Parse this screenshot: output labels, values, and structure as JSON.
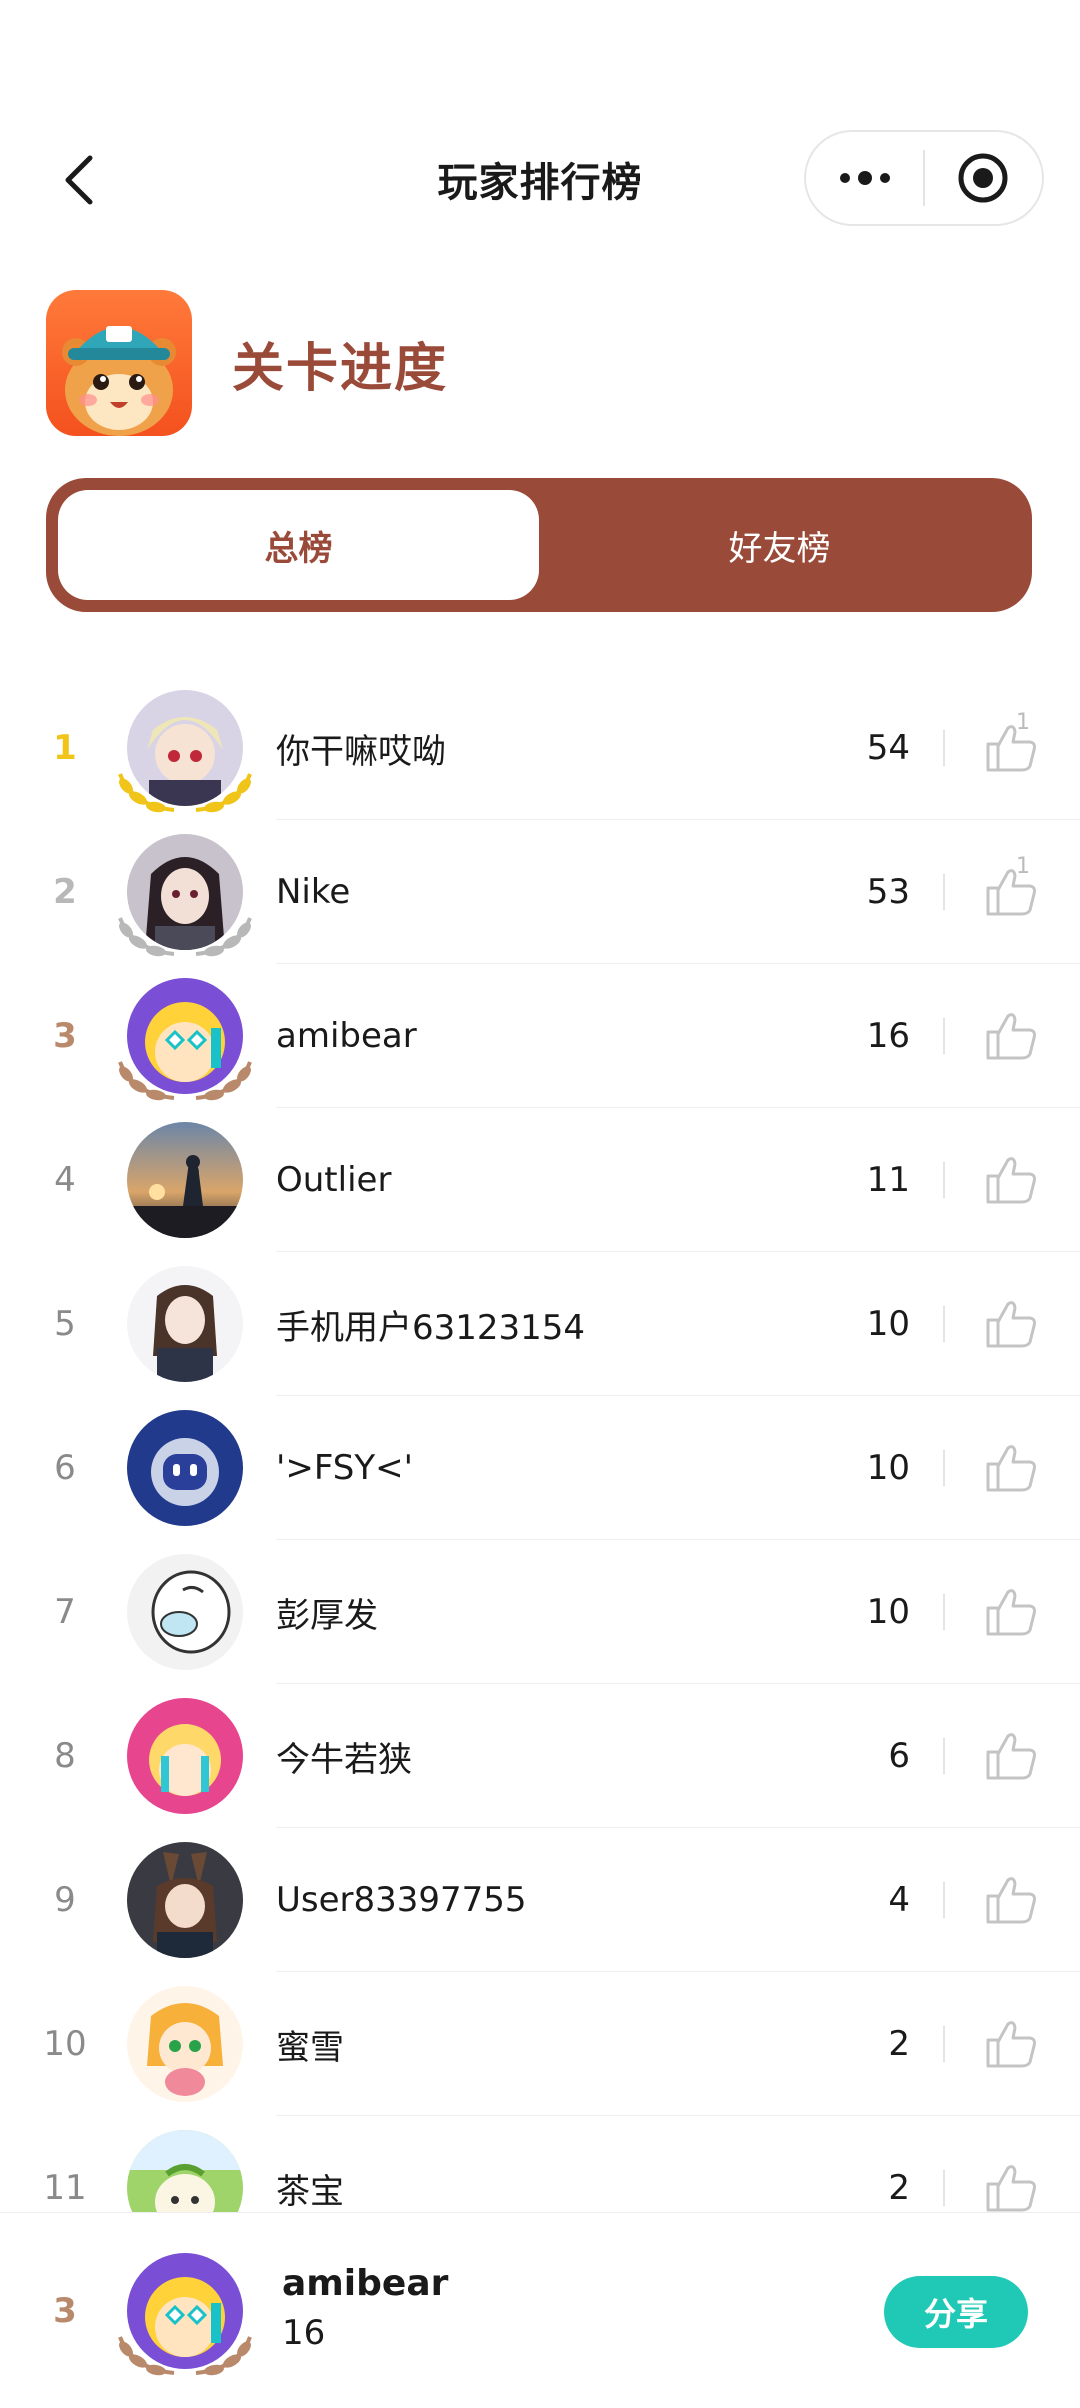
{
  "nav": {
    "title": "玩家排行榜"
  },
  "header": {
    "title": "关卡进度"
  },
  "tabs": [
    {
      "label": "总榜",
      "active": true
    },
    {
      "label": "好友榜",
      "active": false
    }
  ],
  "colors": {
    "accent": "#9a4a38",
    "share": "#20c9b5",
    "gold": "#f0c419",
    "silver": "#b8b8b8",
    "bronze": "#b9896b"
  },
  "rankings": [
    {
      "rank": "1",
      "name": "你干嘛哎呦",
      "score": "54",
      "likes": "1",
      "medal": "gold"
    },
    {
      "rank": "2",
      "name": "Nike",
      "score": "53",
      "likes": "1",
      "medal": "silver"
    },
    {
      "rank": "3",
      "name": "amibear",
      "score": "16",
      "likes": "",
      "medal": "bronze"
    },
    {
      "rank": "4",
      "name": "Outlier",
      "score": "11",
      "likes": "",
      "medal": ""
    },
    {
      "rank": "5",
      "name": "手机用户63123154",
      "score": "10",
      "likes": "",
      "medal": ""
    },
    {
      "rank": "6",
      "name": "'>FSY<'",
      "score": "10",
      "likes": "",
      "medal": ""
    },
    {
      "rank": "7",
      "name": "彭厚发",
      "score": "10",
      "likes": "",
      "medal": ""
    },
    {
      "rank": "8",
      "name": "今牛若狭",
      "score": "6",
      "likes": "",
      "medal": ""
    },
    {
      "rank": "9",
      "name": "User83397755",
      "score": "4",
      "likes": "",
      "medal": ""
    },
    {
      "rank": "10",
      "name": "蜜雪",
      "score": "2",
      "likes": "",
      "medal": ""
    },
    {
      "rank": "11",
      "name": "茶宝",
      "score": "2",
      "likes": "",
      "medal": ""
    }
  ],
  "me": {
    "rank": "3",
    "name": "amibear",
    "score": "16",
    "share_label": "分享"
  }
}
